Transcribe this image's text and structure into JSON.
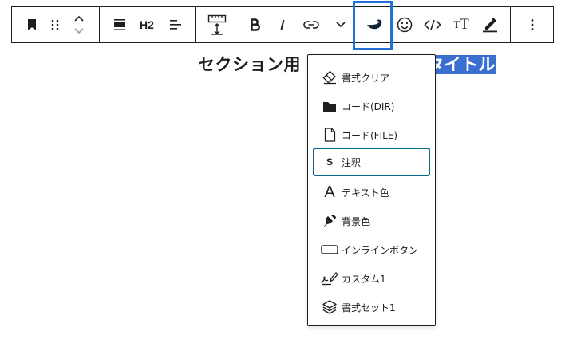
{
  "toolbar": {
    "heading_level": "H2",
    "typography_glyph": "T"
  },
  "editor": {
    "heading_unselected": "セクション用",
    "heading_selected": "タイトル"
  },
  "format_menu": {
    "items": [
      {
        "label": "書式クリア",
        "icon": "eraser-icon"
      },
      {
        "label": "コード(DIR)",
        "icon": "folder-icon"
      },
      {
        "label": "コード(FILE)",
        "icon": "file-icon"
      },
      {
        "label": "注釈",
        "icon": "annotation-s-icon",
        "glyph": "S",
        "focused": true
      },
      {
        "label": "テキスト色",
        "icon": "text-color-icon",
        "glyph": "A"
      },
      {
        "label": "背景色",
        "icon": "paint-brush-icon"
      },
      {
        "label": "インラインボタン",
        "icon": "inline-button-icon"
      },
      {
        "label": "カスタム1",
        "icon": "pen-icon"
      },
      {
        "label": "書式セット1",
        "icon": "stack-icon"
      }
    ]
  },
  "colors": {
    "accent": "#2271d6",
    "selection": "#3b6ed1",
    "focus": "#0a6a8e",
    "text": "#1e1e1e"
  }
}
